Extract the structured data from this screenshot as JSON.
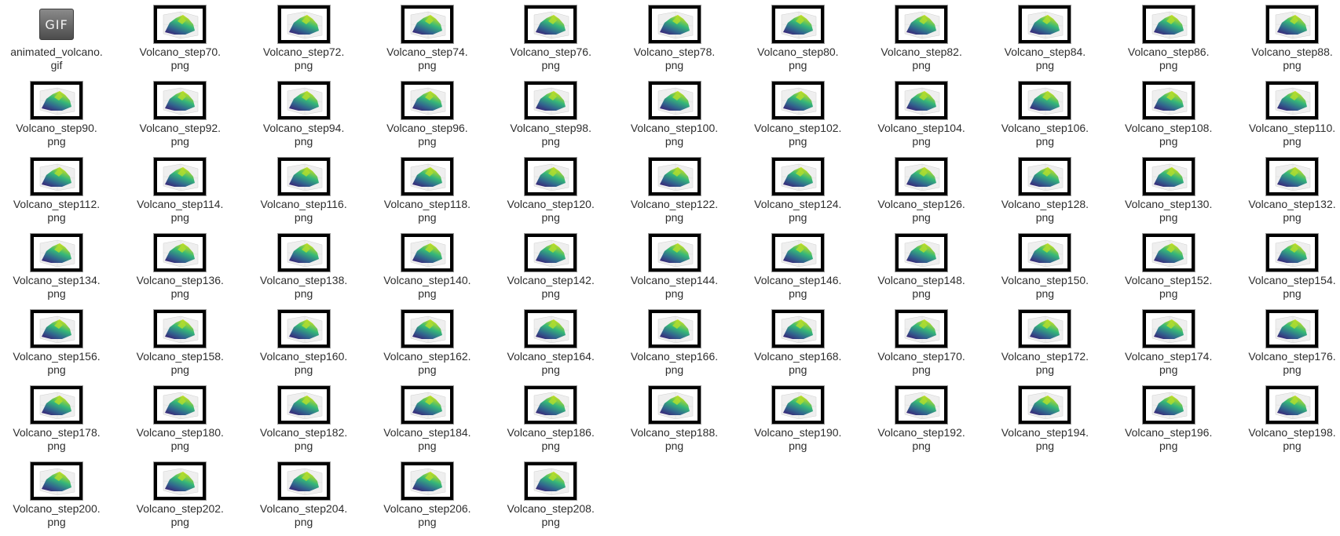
{
  "window": {
    "view": "icon-grid"
  },
  "icon_legend": {
    "gif_badge": "GIF",
    "image_thumbnail": "volcano-plot-thumbnail"
  },
  "files": [
    {
      "line1": "animated_volcano.",
      "line2": "gif",
      "type": "gif"
    },
    {
      "line1": "Volcano_step70.",
      "line2": "png",
      "type": "png"
    },
    {
      "line1": "Volcano_step72.",
      "line2": "png",
      "type": "png"
    },
    {
      "line1": "Volcano_step74.",
      "line2": "png",
      "type": "png"
    },
    {
      "line1": "Volcano_step76.",
      "line2": "png",
      "type": "png"
    },
    {
      "line1": "Volcano_step78.",
      "line2": "png",
      "type": "png"
    },
    {
      "line1": "Volcano_step80.",
      "line2": "png",
      "type": "png"
    },
    {
      "line1": "Volcano_step82.",
      "line2": "png",
      "type": "png"
    },
    {
      "line1": "Volcano_step84.",
      "line2": "png",
      "type": "png"
    },
    {
      "line1": "Volcano_step86.",
      "line2": "png",
      "type": "png"
    },
    {
      "line1": "Volcano_step88.",
      "line2": "png",
      "type": "png"
    },
    {
      "line1": "Volcano_step90.",
      "line2": "png",
      "type": "png"
    },
    {
      "line1": "Volcano_step92.",
      "line2": "png",
      "type": "png"
    },
    {
      "line1": "Volcano_step94.",
      "line2": "png",
      "type": "png"
    },
    {
      "line1": "Volcano_step96.",
      "line2": "png",
      "type": "png"
    },
    {
      "line1": "Volcano_step98.",
      "line2": "png",
      "type": "png"
    },
    {
      "line1": "Volcano_step100.",
      "line2": "png",
      "type": "png"
    },
    {
      "line1": "Volcano_step102.",
      "line2": "png",
      "type": "png"
    },
    {
      "line1": "Volcano_step104.",
      "line2": "png",
      "type": "png"
    },
    {
      "line1": "Volcano_step106.",
      "line2": "png",
      "type": "png"
    },
    {
      "line1": "Volcano_step108.",
      "line2": "png",
      "type": "png"
    },
    {
      "line1": "Volcano_step110.",
      "line2": "png",
      "type": "png"
    },
    {
      "line1": "Volcano_step112.",
      "line2": "png",
      "type": "png"
    },
    {
      "line1": "Volcano_step114.",
      "line2": "png",
      "type": "png"
    },
    {
      "line1": "Volcano_step116.",
      "line2": "png",
      "type": "png"
    },
    {
      "line1": "Volcano_step118.",
      "line2": "png",
      "type": "png"
    },
    {
      "line1": "Volcano_step120.",
      "line2": "png",
      "type": "png"
    },
    {
      "line1": "Volcano_step122.",
      "line2": "png",
      "type": "png"
    },
    {
      "line1": "Volcano_step124.",
      "line2": "png",
      "type": "png"
    },
    {
      "line1": "Volcano_step126.",
      "line2": "png",
      "type": "png"
    },
    {
      "line1": "Volcano_step128.",
      "line2": "png",
      "type": "png"
    },
    {
      "line1": "Volcano_step130.",
      "line2": "png",
      "type": "png"
    },
    {
      "line1": "Volcano_step132.",
      "line2": "png",
      "type": "png"
    },
    {
      "line1": "Volcano_step134.",
      "line2": "png",
      "type": "png"
    },
    {
      "line1": "Volcano_step136.",
      "line2": "png",
      "type": "png"
    },
    {
      "line1": "Volcano_step138.",
      "line2": "png",
      "type": "png"
    },
    {
      "line1": "Volcano_step140.",
      "line2": "png",
      "type": "png"
    },
    {
      "line1": "Volcano_step142.",
      "line2": "png",
      "type": "png"
    },
    {
      "line1": "Volcano_step144.",
      "line2": "png",
      "type": "png"
    },
    {
      "line1": "Volcano_step146.",
      "line2": "png",
      "type": "png"
    },
    {
      "line1": "Volcano_step148.",
      "line2": "png",
      "type": "png"
    },
    {
      "line1": "Volcano_step150.",
      "line2": "png",
      "type": "png"
    },
    {
      "line1": "Volcano_step152.",
      "line2": "png",
      "type": "png"
    },
    {
      "line1": "Volcano_step154.",
      "line2": "png",
      "type": "png"
    },
    {
      "line1": "Volcano_step156.",
      "line2": "png",
      "type": "png"
    },
    {
      "line1": "Volcano_step158.",
      "line2": "png",
      "type": "png"
    },
    {
      "line1": "Volcano_step160.",
      "line2": "png",
      "type": "png"
    },
    {
      "line1": "Volcano_step162.",
      "line2": "png",
      "type": "png"
    },
    {
      "line1": "Volcano_step164.",
      "line2": "png",
      "type": "png"
    },
    {
      "line1": "Volcano_step166.",
      "line2": "png",
      "type": "png"
    },
    {
      "line1": "Volcano_step168.",
      "line2": "png",
      "type": "png"
    },
    {
      "line1": "Volcano_step170.",
      "line2": "png",
      "type": "png"
    },
    {
      "line1": "Volcano_step172.",
      "line2": "png",
      "type": "png"
    },
    {
      "line1": "Volcano_step174.",
      "line2": "png",
      "type": "png"
    },
    {
      "line1": "Volcano_step176.",
      "line2": "png",
      "type": "png"
    },
    {
      "line1": "Volcano_step178.",
      "line2": "png",
      "type": "png"
    },
    {
      "line1": "Volcano_step180.",
      "line2": "png",
      "type": "png"
    },
    {
      "line1": "Volcano_step182.",
      "line2": "png",
      "type": "png"
    },
    {
      "line1": "Volcano_step184.",
      "line2": "png",
      "type": "png"
    },
    {
      "line1": "Volcano_step186.",
      "line2": "png",
      "type": "png"
    },
    {
      "line1": "Volcano_step188.",
      "line2": "png",
      "type": "png"
    },
    {
      "line1": "Volcano_step190.",
      "line2": "png",
      "type": "png"
    },
    {
      "line1": "Volcano_step192.",
      "line2": "png",
      "type": "png"
    },
    {
      "line1": "Volcano_step194.",
      "line2": "png",
      "type": "png"
    },
    {
      "line1": "Volcano_step196.",
      "line2": "png",
      "type": "png"
    },
    {
      "line1": "Volcano_step198.",
      "line2": "png",
      "type": "png"
    },
    {
      "line1": "Volcano_step200.",
      "line2": "png",
      "type": "png"
    },
    {
      "line1": "Volcano_step202.",
      "line2": "png",
      "type": "png"
    },
    {
      "line1": "Volcano_step204.",
      "line2": "png",
      "type": "png"
    },
    {
      "line1": "Volcano_step206.",
      "line2": "png",
      "type": "png"
    },
    {
      "line1": "Volcano_step208.",
      "line2": "png",
      "type": "png"
    }
  ]
}
